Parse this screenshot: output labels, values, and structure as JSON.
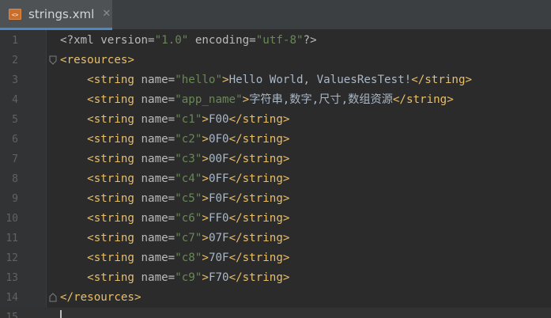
{
  "tab": {
    "filename": "strings.xml",
    "close_glyph": "✕"
  },
  "colors": {
    "tag": "#e8bf6a",
    "attr": "#bababa",
    "value": "#6a8759",
    "text": "#a9b7c6",
    "line_number": "#606366",
    "background": "#2b2b2b",
    "tab_active_underline": "#4a88c7"
  },
  "editor": {
    "lines": [
      {
        "num": "1",
        "decl": {
          "open": "<?xml",
          "version_attr": " version=",
          "version_val": "\"1.0\"",
          "encoding_attr": " encoding=",
          "encoding_val": "\"utf-8\"",
          "close": "?>"
        }
      },
      {
        "num": "2",
        "open_tag": "<resources>"
      },
      {
        "num": "3",
        "indent": "    ",
        "open": "<string",
        "attr": " name=",
        "value": "\"hello\"",
        "gt": ">",
        "text": "Hello World, ValuesResTest!",
        "close": "</string>"
      },
      {
        "num": "4",
        "indent": "    ",
        "open": "<string",
        "attr": " name=",
        "value": "\"app_name\"",
        "gt": ">",
        "text": "字符串,数字,尺寸,数组资源",
        "close": "</string>"
      },
      {
        "num": "5",
        "indent": "    ",
        "open": "<string",
        "attr": " name=",
        "value": "\"c1\"",
        "gt": ">",
        "text": "F00",
        "close": "</string>"
      },
      {
        "num": "6",
        "indent": "    ",
        "open": "<string",
        "attr": " name=",
        "value": "\"c2\"",
        "gt": ">",
        "text": "0F0",
        "close": "</string>"
      },
      {
        "num": "7",
        "indent": "    ",
        "open": "<string",
        "attr": " name=",
        "value": "\"c3\"",
        "gt": ">",
        "text": "00F",
        "close": "</string>"
      },
      {
        "num": "8",
        "indent": "    ",
        "open": "<string",
        "attr": " name=",
        "value": "\"c4\"",
        "gt": ">",
        "text": "0FF",
        "close": "</string>"
      },
      {
        "num": "9",
        "indent": "    ",
        "open": "<string",
        "attr": " name=",
        "value": "\"c5\"",
        "gt": ">",
        "text": "F0F",
        "close": "</string>"
      },
      {
        "num": "10",
        "indent": "    ",
        "open": "<string",
        "attr": " name=",
        "value": "\"c6\"",
        "gt": ">",
        "text": "FF0",
        "close": "</string>"
      },
      {
        "num": "11",
        "indent": "    ",
        "open": "<string",
        "attr": " name=",
        "value": "\"c7\"",
        "gt": ">",
        "text": "07F",
        "close": "</string>"
      },
      {
        "num": "12",
        "indent": "    ",
        "open": "<string",
        "attr": " name=",
        "value": "\"c8\"",
        "gt": ">",
        "text": "70F",
        "close": "</string>"
      },
      {
        "num": "13",
        "indent": "    ",
        "open": "<string",
        "attr": " name=",
        "value": "\"c9\"",
        "gt": ">",
        "text": "F70",
        "close": "</string>"
      },
      {
        "num": "14",
        "close_tag": "</resources>"
      },
      {
        "num": "15",
        "empty": true
      }
    ]
  }
}
